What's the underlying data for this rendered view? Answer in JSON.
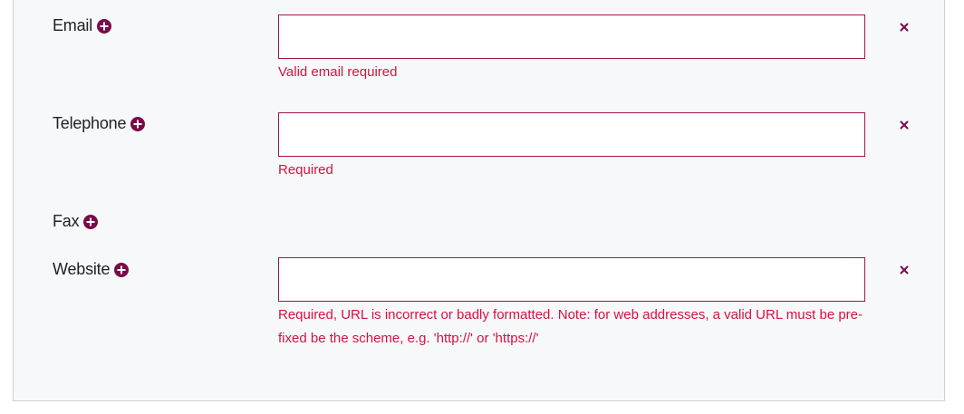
{
  "form": {
    "rows": [
      {
        "label": "Email",
        "value": "",
        "error": "Valid email required"
      },
      {
        "label": "Telephone",
        "value": "",
        "error": "Required"
      },
      {
        "label": "Fax"
      },
      {
        "label": "Website",
        "value": "",
        "error": "Required, URL is incorrect or badly formatted. Note: for web addresses, a valid URL must be pre-fixed be the scheme, e.g. 'http://' or 'https://'"
      }
    ]
  },
  "colors": {
    "accent": "#7a0a4a",
    "error": "#d6123f",
    "field_border": "#a4124d",
    "panel_bg": "#f7f8fa"
  },
  "icons": {
    "add": "plus-circle-icon",
    "remove": "close-icon"
  }
}
